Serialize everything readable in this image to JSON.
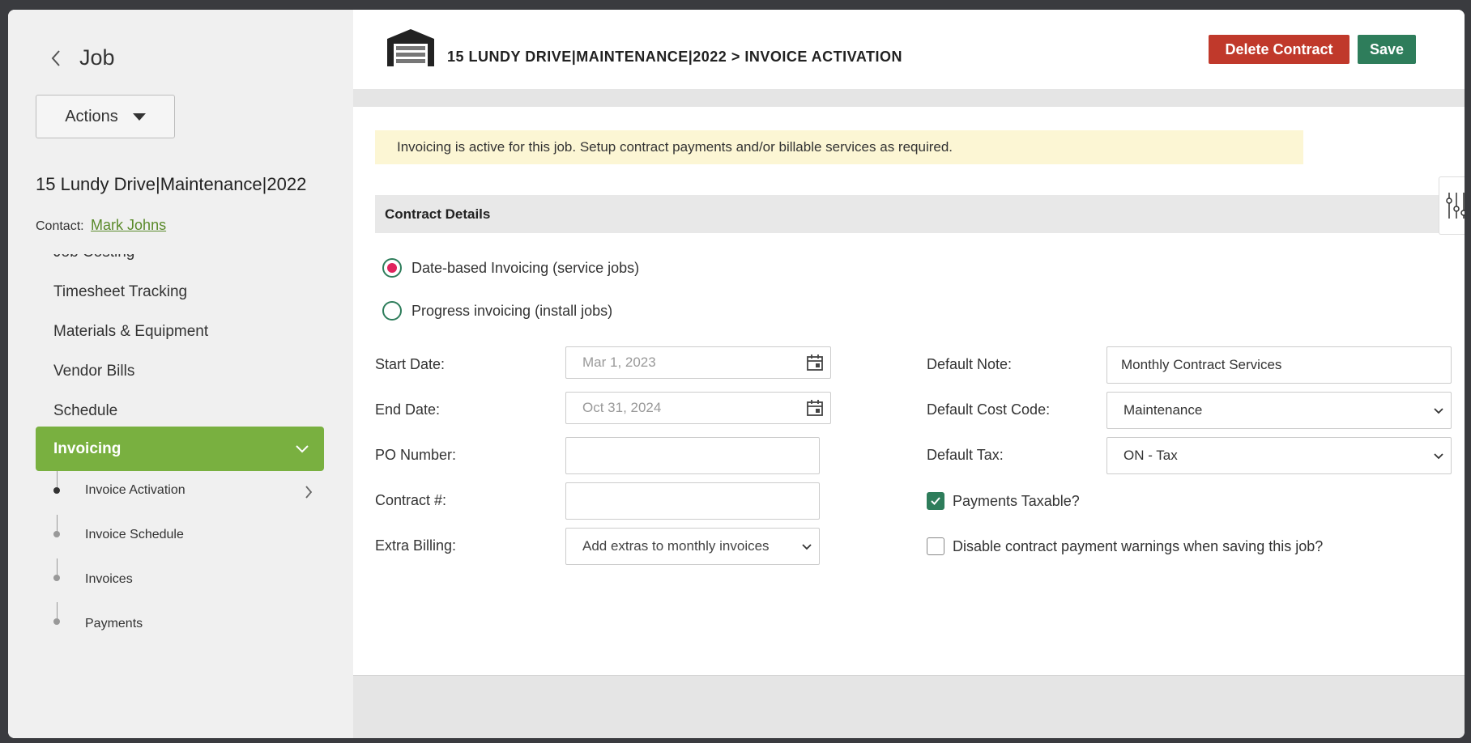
{
  "sidebar": {
    "title": "Job",
    "actions_label": "Actions",
    "job_name": "15 Lundy Drive|Maintenance|2022",
    "contact_label": "Contact:",
    "contact_name": "Mark Johns",
    "nav_items": [
      {
        "label": "Job Costing"
      },
      {
        "label": "Timesheet Tracking"
      },
      {
        "label": "Materials & Equipment"
      },
      {
        "label": "Vendor Bills"
      },
      {
        "label": "Schedule"
      }
    ],
    "active_item": "Invoicing",
    "sub_items": [
      {
        "label": "Invoice Activation"
      },
      {
        "label": "Invoice Schedule"
      },
      {
        "label": "Invoices"
      },
      {
        "label": "Payments"
      }
    ]
  },
  "header": {
    "breadcrumb": "15 LUNDY DRIVE|MAINTENANCE|2022 > INVOICE ACTIVATION",
    "delete_label": "Delete Contract",
    "save_label": "Save"
  },
  "notice": "Invoicing is active for this job. Setup contract payments and/or billable services as required.",
  "section_title": "Contract Details",
  "invoicing_options": [
    {
      "label": "Date-based Invoicing (service jobs)",
      "selected": true
    },
    {
      "label": "Progress invoicing (install jobs)",
      "selected": false
    }
  ],
  "form": {
    "start_date_label": "Start Date:",
    "start_date_value": "Mar 1, 2023",
    "end_date_label": "End Date:",
    "end_date_value": "Oct 31, 2024",
    "po_label": "PO Number:",
    "po_value": "",
    "contract_label": "Contract #:",
    "contract_value": "",
    "extra_billing_label": "Extra Billing:",
    "extra_billing_value": "Add extras to monthly invoices",
    "default_note_label": "Default Note:",
    "default_note_value": "Monthly Contract Services",
    "cost_code_label": "Default Cost Code:",
    "cost_code_value": "Maintenance",
    "tax_label": "Default Tax:",
    "tax_value": "ON - Tax",
    "payments_taxable_label": "Payments Taxable?",
    "payments_taxable_checked": true,
    "disable_warnings_label": "Disable contract payment warnings when saving this job?",
    "disable_warnings_checked": false
  },
  "colors": {
    "accent_green": "#79b040",
    "save_green": "#2e7d5b",
    "delete_red": "#c0392b",
    "link_green": "#5a8a2a",
    "radio_selected": "#e0245e",
    "notice_bg": "#fcf6d4"
  },
  "icons": [
    "chevron-left-icon",
    "caret-down-icon",
    "chevron-down-icon",
    "chevron-right-icon",
    "garage-icon",
    "calendar-icon",
    "filter-sliders-icon",
    "checkmark-icon"
  ]
}
